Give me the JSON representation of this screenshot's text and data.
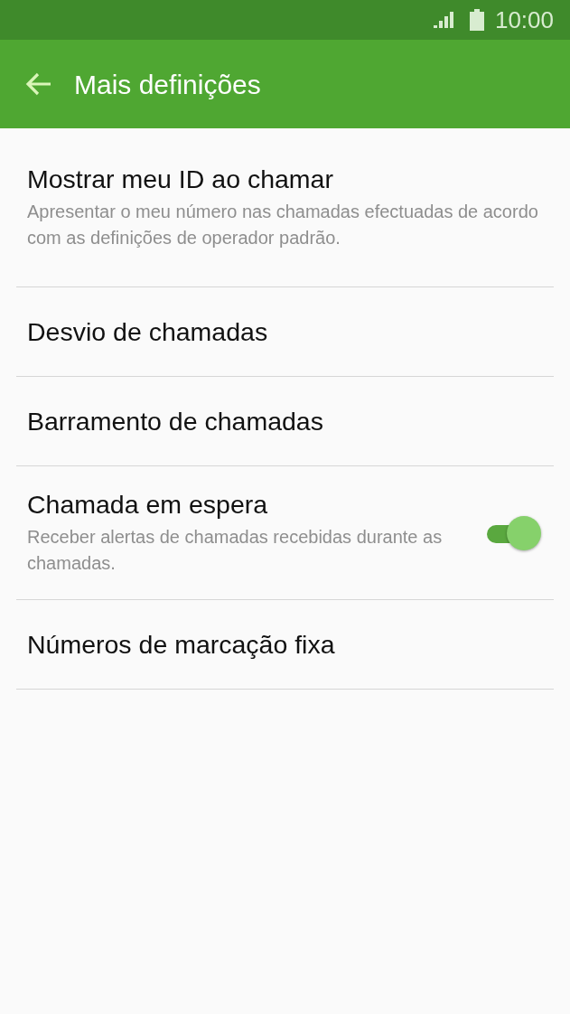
{
  "status_bar": {
    "time": "10:00"
  },
  "app_bar": {
    "title": "Mais definições"
  },
  "items": [
    {
      "kind": "plain",
      "title": "Mostrar meu ID ao chamar",
      "subtitle": "Apresentar o meu número nas chamadas efectuadas de acordo com as definições de operador padrão."
    },
    {
      "kind": "plain",
      "title": "Desvio de chamadas"
    },
    {
      "kind": "plain",
      "title": "Barramento de chamadas"
    },
    {
      "kind": "toggle",
      "title": "Chamada em espera",
      "subtitle": "Receber alertas de chamadas recebidas durante as chamadas.",
      "on": true
    },
    {
      "kind": "plain",
      "title": "Números de marcação fixa"
    }
  ]
}
